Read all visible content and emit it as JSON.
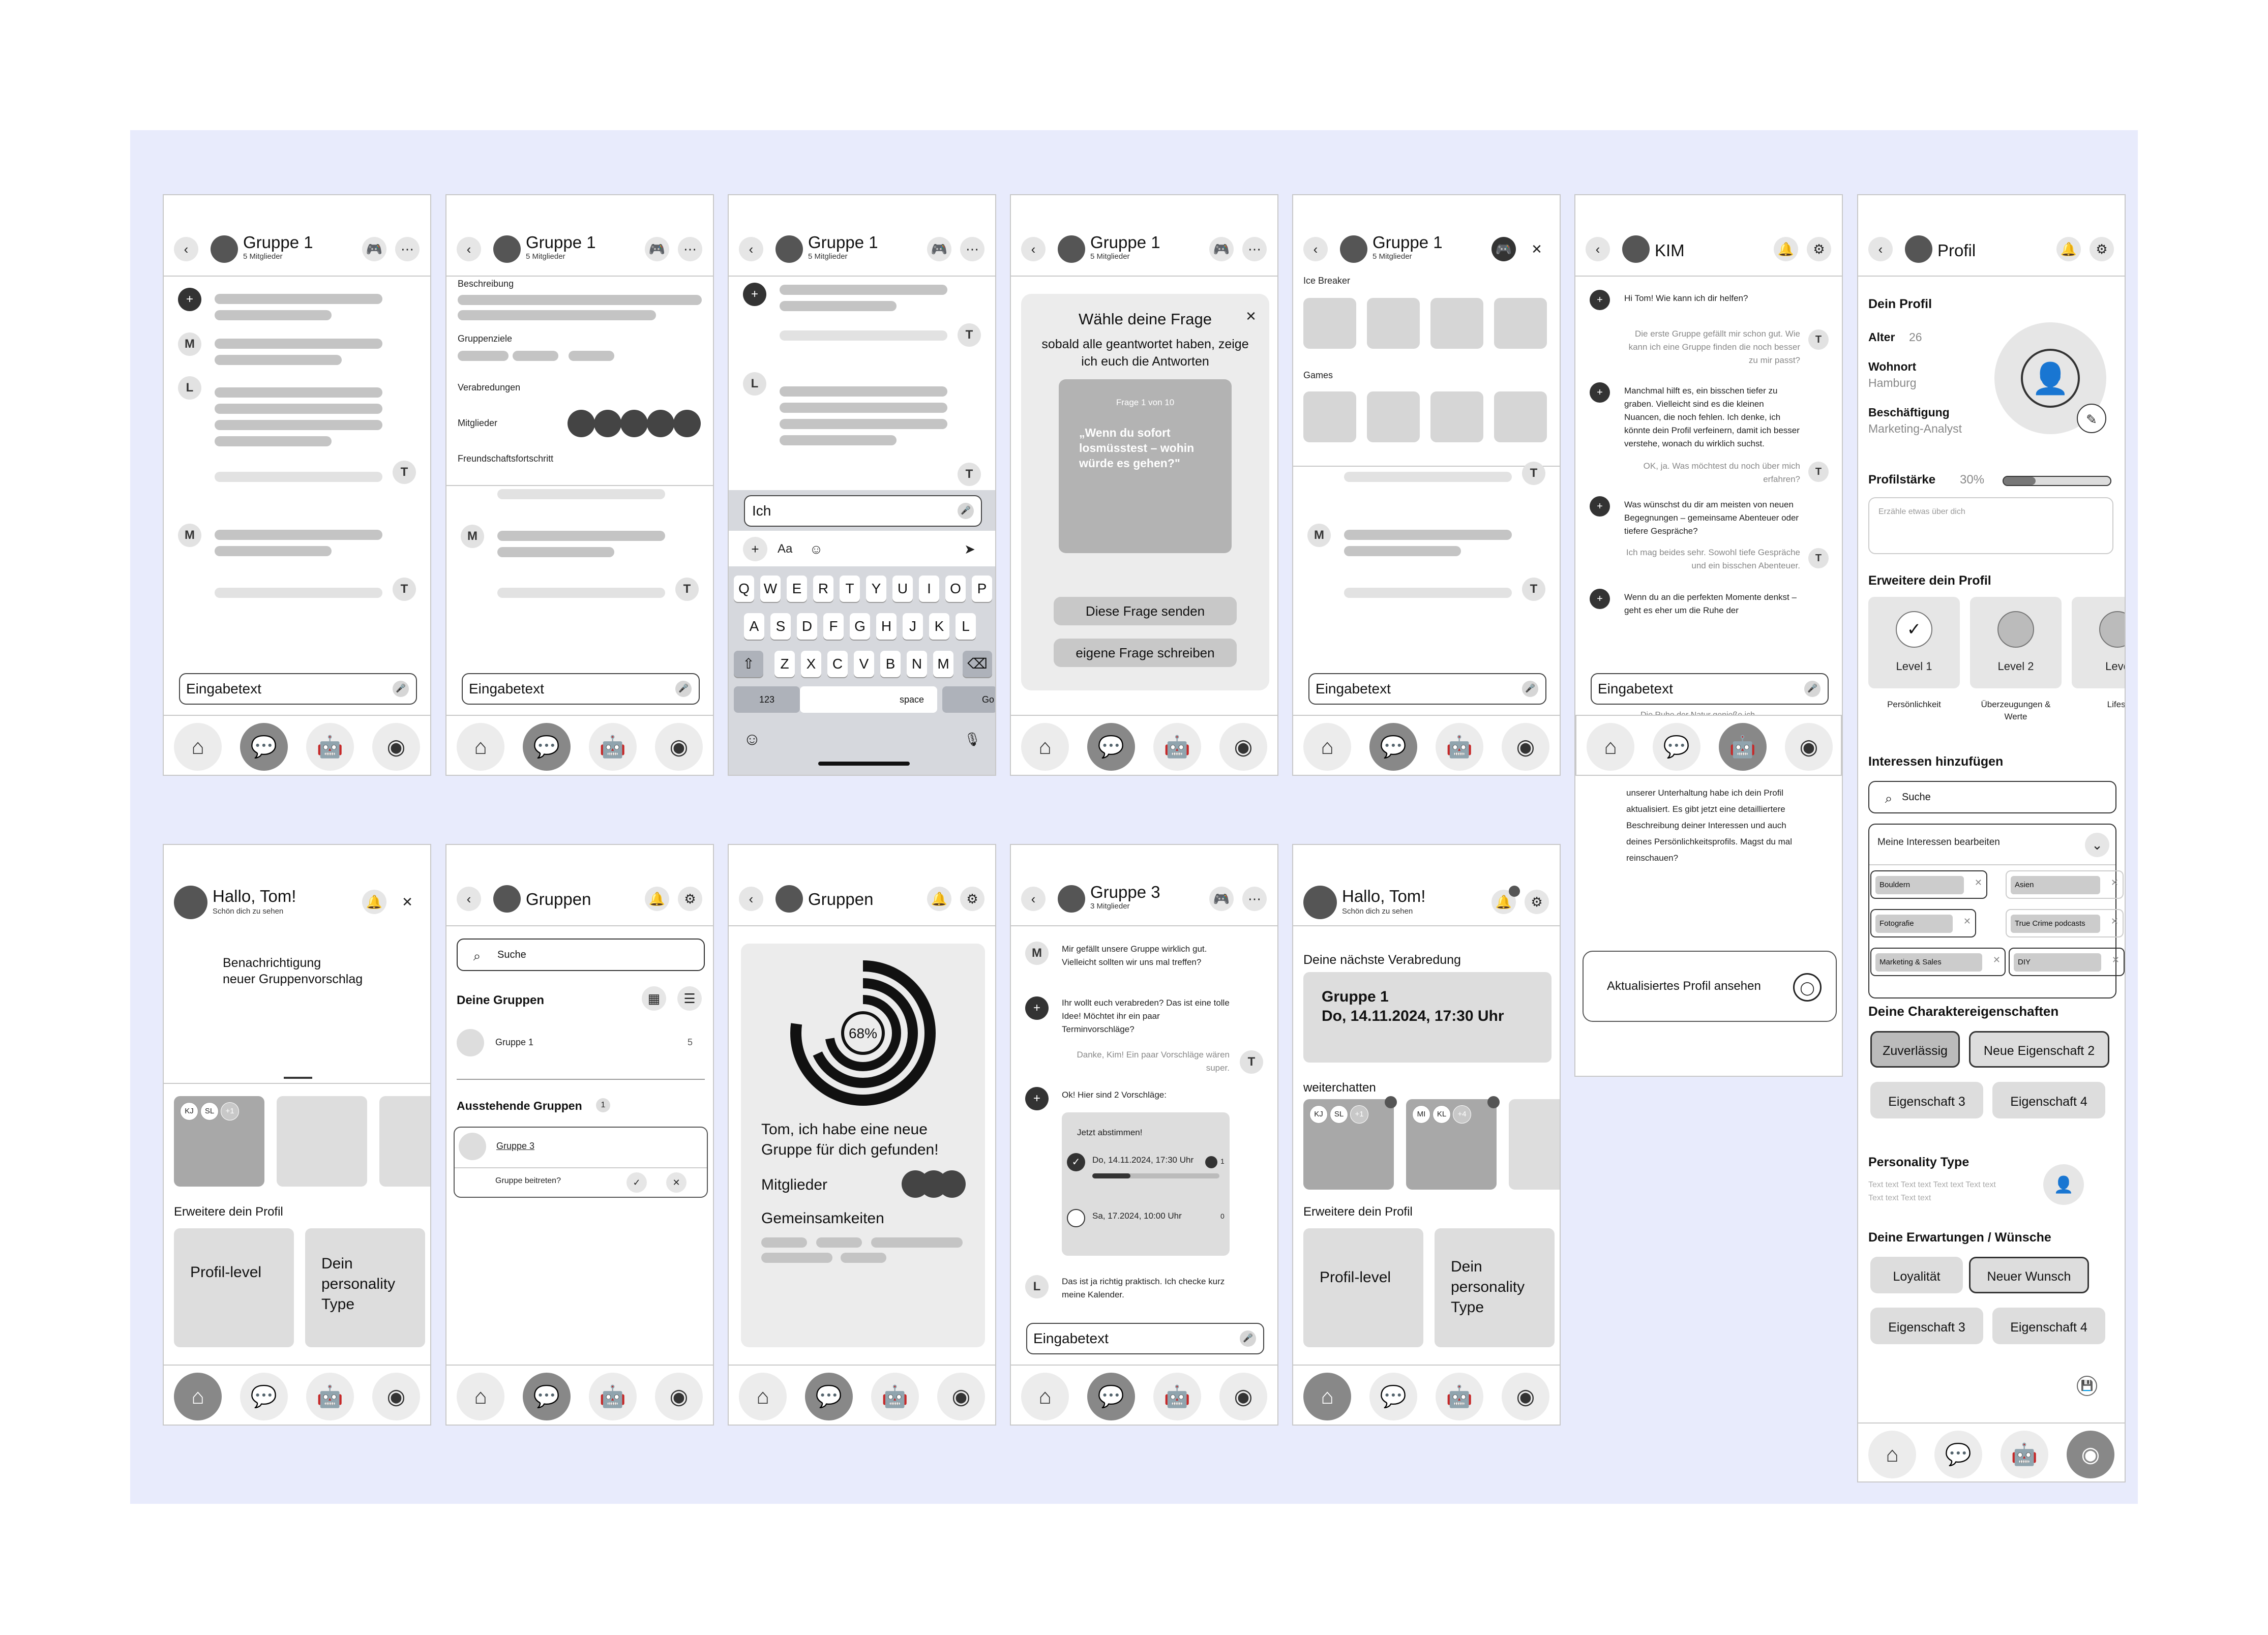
{
  "nav": {
    "home": "⌂",
    "chat": "💬",
    "robot": "🤖",
    "profile": "◉"
  },
  "group1": {
    "title": "Gruppe 1",
    "members": "5 Mitglieder"
  },
  "chat": {
    "input": "Eingabetext"
  },
  "groupinfo": {
    "beschreibung": "Beschreibung",
    "ziele": "Gruppenziele",
    "verabredungen": "Verabredungen",
    "mitglieder": "Mitglieder",
    "fortschritt": "Freundschaftsfortschritt"
  },
  "keyboard": {
    "input": "Ich",
    "aa": "Aa",
    "row1": [
      "Q",
      "W",
      "E",
      "R",
      "T",
      "Y",
      "U",
      "I",
      "O",
      "P"
    ],
    "row2": [
      "A",
      "S",
      "D",
      "F",
      "G",
      "H",
      "J",
      "K",
      "L"
    ],
    "row3": [
      "Z",
      "X",
      "C",
      "V",
      "B",
      "N",
      "M"
    ],
    "num": "123",
    "space": "space",
    "go": "Go"
  },
  "question": {
    "title": "Wähle deine Frage",
    "sub": "sobald alle geantwortet haben, zeige ich euch die Antworten",
    "counter": "Frage 1 von 10",
    "text": "„Wenn du sofort losmüsstest – wohin würde es gehen?\"",
    "send": "Diese Frage senden",
    "own": "eigene Frage schreiben"
  },
  "games": {
    "icebreaker": "Ice Breaker",
    "games": "Games"
  },
  "kim": {
    "title": "KIM",
    "messages": [
      {
        "role": "bot",
        "text": "Hi Tom! Wie kann ich dir helfen?"
      },
      {
        "role": "user",
        "text": "Die erste Gruppe gefällt mir schon gut. Wie kann ich eine Gruppe finden die noch besser zu mir passt?"
      },
      {
        "role": "bot",
        "text": "Manchmal hilft es, ein bisschen tiefer zu graben. Vielleicht sind es die kleinen Nuancen, die noch fehlen. Ich denke, ich könnte dein Profil verfeinern, damit ich besser verstehe, wonach du wirklich suchst."
      },
      {
        "role": "user",
        "text": "OK, ja. Was möchtest du noch über mich erfahren?"
      },
      {
        "role": "bot",
        "text": "Was wünschst du dir am meisten von neuen Begegnungen – gemeinsame Abenteuer oder tiefere Gespräche?"
      },
      {
        "role": "user",
        "text": "Ich mag beides sehr. Sowohl tiefe Gespräche und ein bisschen Abenteuer."
      },
      {
        "role": "bot",
        "text": "Wenn du an die perfekten Momente denkst – geht es eher um die Ruhe der"
      }
    ],
    "overflow1": "Die Ruhe der Natur genieße ich",
    "overflow2": "unserer Unterhaltung habe ich dein Profil aktualisiert. Es gibt jetzt eine detailliertere Beschreibung deiner Interessen und auch deines Persönlichkeitsprofils. Magst du mal reinschauen?",
    "profile_btn": "Aktualisiertes Profil ansehen"
  },
  "profile": {
    "title": "Profil",
    "dein": "Dein Profil",
    "alter_l": "Alter",
    "alter": "26",
    "wohnort_l": "Wohnort",
    "wohnort": "Hamburg",
    "job_l": "Beschäftigung",
    "job": "Marketing-Analyst",
    "staerke_l": "Profilstärke",
    "staerke": "30%",
    "about_ph": "Erzähle etwas über dich",
    "erweitere": "Erweitere dein Profil",
    "levels": [
      {
        "name": "Level 1",
        "sub": "Persönlichkeit"
      },
      {
        "name": "Level 2",
        "sub": "Überzeugungen & Werte"
      },
      {
        "name": "Leve",
        "sub": "Lifest"
      }
    ],
    "interessen": "Interessen hinzufügen",
    "suche": "Suche",
    "bearbeiten": "Meine Interessen bearbeiten",
    "tags": [
      "Bouldern",
      "Asien",
      "Fotografie",
      "True Crime podcasts",
      "Marketing & Sales",
      "DIY"
    ],
    "char_title": "Deine Charaktereigenschaften",
    "char": [
      "Zuverlässig",
      "Neue Eigenschaft 2",
      "Eigenschaft 3",
      "Eigenschaft 4"
    ],
    "pt_title": "Personality Type",
    "pt_text": "Text text Text text Text text Text text Text text Text text",
    "wish_title": "Deine Erwartungen / Wünsche",
    "wish": [
      "Loyalität",
      "Neuer Wunsch",
      "Eigenschaft 3",
      "Eigenschaft 4"
    ]
  },
  "home": {
    "greet": "Hallo, Tom!",
    "sub": "Schön dich zu sehen",
    "notif1": "Benachrichtigung",
    "notif2": "neuer Gruppenvorschlag",
    "erweitere": "Erweitere dein Profil",
    "level": "Profil-level",
    "ptype": "Dein personality Type",
    "avatars": [
      "KJ",
      "SL",
      "+1"
    ]
  },
  "groups": {
    "title": "Gruppen",
    "suche": "Suche",
    "deine": "Deine Gruppen",
    "g1": "Gruppe 1",
    "g1n": "5",
    "ausstehend": "Ausstehende Gruppen",
    "ausstehend_n": "1",
    "g3": "Gruppe 3",
    "beitreten": "Gruppe beitreten?"
  },
  "match": {
    "title": "Gruppen",
    "pct": "68%",
    "msg": "Tom, ich habe eine neue Gruppe für dich gefunden!",
    "mitglieder": "Mitglieder",
    "gemeinsam": "Gemeinsamkeiten"
  },
  "group3": {
    "title": "Gruppe 3",
    "members": "3 Mitglieder",
    "m1": "Mir gefällt unsere Gruppe wirklich gut. Vielleicht sollten wir uns mal treffen?",
    "m2": "Ihr wollt euch verabreden? Das ist eine tolle Idee! Möchtet ihr ein paar Terminvorschläge?",
    "m3": "Danke, Kim! Ein paar Vorschläge wären super.",
    "m4": "Ok! Hier sind 2 Vorschläge:",
    "poll": "Jetzt abstimmen!",
    "opt1": "Do, 14.11.2024, 17:30 Uhr",
    "opt1n": "1",
    "opt2": "Sa, 17.2024, 10:00 Uhr",
    "opt2n": "0",
    "m5": "Das ist ja richtig praktisch. Ich checke kurz meine Kalender."
  },
  "home2": {
    "next": "Deine nächste Verabredung",
    "grp": "Gruppe 1",
    "date": "Do, 14.11.2024, 17:30 Uhr",
    "weiter": "weiterchatten",
    "av1": [
      "KJ",
      "SL",
      "+1"
    ],
    "av2": [
      "MI",
      "KL",
      "+4"
    ]
  },
  "letters": {
    "M": "M",
    "L": "L",
    "T": "T"
  }
}
